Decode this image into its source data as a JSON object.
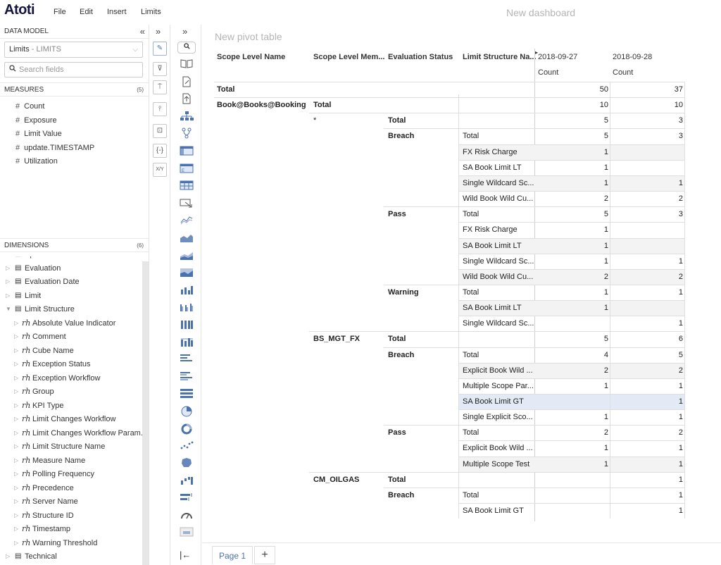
{
  "app": {
    "logo": "Atoti",
    "dashboard_title": "New dashboard"
  },
  "menu": [
    "File",
    "Edit",
    "Insert",
    "Limits"
  ],
  "left_panel": {
    "data_model_title": "DATA MODEL",
    "collapse_icon": "«",
    "cube": {
      "name": "Limits",
      "sep": " - ",
      "id": "LIMITS",
      "chevron": "⌵"
    },
    "search": {
      "placeholder": "Search fields",
      "value": ""
    },
    "measures_title": "MEASURES",
    "measures_count": "(5)",
    "measures": [
      "Count",
      "Exposure",
      "Limit Value",
      "update.TIMESTAMP",
      "Utilization"
    ],
    "dimensions_title": "DIMENSIONS",
    "dimensions_count": "(6)",
    "dimensions": [
      {
        "label": "Epoch",
        "kind": "dim"
      },
      {
        "label": "Evaluation",
        "kind": "dim"
      },
      {
        "label": "Evaluation Date",
        "kind": "dim"
      },
      {
        "label": "Limit",
        "kind": "dim"
      },
      {
        "label": "Limit Structure",
        "kind": "dim-open"
      },
      {
        "label": "Absolute Value Indicator",
        "kind": "hier"
      },
      {
        "label": "Comment",
        "kind": "hier"
      },
      {
        "label": "Cube Name",
        "kind": "hier"
      },
      {
        "label": "Exception Status",
        "kind": "hier"
      },
      {
        "label": "Exception Workflow",
        "kind": "hier"
      },
      {
        "label": "Group",
        "kind": "hier"
      },
      {
        "label": "KPI Type",
        "kind": "hier"
      },
      {
        "label": "Limit Changes Workflow",
        "kind": "hier"
      },
      {
        "label": "Limit Changes Workflow Param...",
        "kind": "hier"
      },
      {
        "label": "Limit Structure Name",
        "kind": "hier"
      },
      {
        "label": "Measure Name",
        "kind": "hier"
      },
      {
        "label": "Polling Frequency",
        "kind": "hier"
      },
      {
        "label": "Precedence",
        "kind": "hier"
      },
      {
        "label": "Server Name",
        "kind": "hier"
      },
      {
        "label": "Structure ID",
        "kind": "hier"
      },
      {
        "label": "Timestamp",
        "kind": "hier"
      },
      {
        "label": "Warning Threshold",
        "kind": "hier"
      },
      {
        "label": "Technical",
        "kind": "dim"
      }
    ]
  },
  "toolbar1": {
    "expand_icon": "»",
    "tools": [
      "pencil-icon",
      "filter-icon",
      "format-paint-icon",
      "sliders-icon",
      "terminal-icon",
      "braces-icon",
      "xy-icon"
    ],
    "tool_glyphs": [
      "✎",
      "⊽",
      "⍑",
      "⫯",
      "⊡",
      "{-}",
      "X/Y"
    ]
  },
  "toolbar2": {
    "expand_icon": "»",
    "search_glyph": "⚲",
    "footer_icon": "|←"
  },
  "pivot": {
    "title": "New pivot table",
    "row_headers": [
      "Scope Level Name",
      "Scope Level Mem...",
      "Evaluation Status",
      "Limit Structure Na..."
    ],
    "dates": [
      "2018-09-27",
      "2018-09-28"
    ],
    "measure": "Count",
    "rows": [
      {
        "c1": "Total",
        "c2": "",
        "c3": "",
        "c4": "",
        "v1": "50",
        "v2": "37",
        "bold": [
          1
        ]
      },
      {
        "c1": "Book@Books@Booking",
        "c2": "Total",
        "c3": "",
        "c4": "",
        "v1": "10",
        "v2": "10",
        "bold": [
          1,
          2
        ]
      },
      {
        "c1": "",
        "c2": "*",
        "c3": "Total",
        "c4": "",
        "v1": "5",
        "v2": "3",
        "bold": [
          3
        ]
      },
      {
        "c1": "",
        "c2": "",
        "c3": "Breach",
        "c4": "Total",
        "v1": "5",
        "v2": "3",
        "bold": [
          3
        ]
      },
      {
        "c1": "",
        "c2": "",
        "c3": "",
        "c4": "FX Risk Charge",
        "v1": "1",
        "v2": ""
      },
      {
        "c1": "",
        "c2": "",
        "c3": "",
        "c4": "SA Book Limit LT",
        "v1": "1",
        "v2": ""
      },
      {
        "c1": "",
        "c2": "",
        "c3": "",
        "c4": "Single Wildcard Sc...",
        "v1": "1",
        "v2": "1"
      },
      {
        "c1": "",
        "c2": "",
        "c3": "",
        "c4": "Wild Book Wild Cu...",
        "v1": "2",
        "v2": "2"
      },
      {
        "c1": "",
        "c2": "",
        "c3": "Pass",
        "c4": "Total",
        "v1": "5",
        "v2": "3",
        "bold": [
          3
        ]
      },
      {
        "c1": "",
        "c2": "",
        "c3": "",
        "c4": "FX Risk Charge",
        "v1": "1",
        "v2": ""
      },
      {
        "c1": "",
        "c2": "",
        "c3": "",
        "c4": "SA Book Limit LT",
        "v1": "1",
        "v2": ""
      },
      {
        "c1": "",
        "c2": "",
        "c3": "",
        "c4": "Single Wildcard Sc...",
        "v1": "1",
        "v2": "1"
      },
      {
        "c1": "",
        "c2": "",
        "c3": "",
        "c4": "Wild Book Wild Cu...",
        "v1": "2",
        "v2": "2"
      },
      {
        "c1": "",
        "c2": "",
        "c3": "Warning",
        "c4": "Total",
        "v1": "1",
        "v2": "1",
        "bold": [
          3
        ]
      },
      {
        "c1": "",
        "c2": "",
        "c3": "",
        "c4": "SA Book Limit LT",
        "v1": "1",
        "v2": ""
      },
      {
        "c1": "",
        "c2": "",
        "c3": "",
        "c4": "Single Wildcard Sc...",
        "v1": "",
        "v2": "1"
      },
      {
        "c1": "",
        "c2": "BS_MGT_FX",
        "c3": "Total",
        "c4": "",
        "v1": "5",
        "v2": "6",
        "bold": [
          2,
          3
        ]
      },
      {
        "c1": "",
        "c2": "",
        "c3": "Breach",
        "c4": "Total",
        "v1": "4",
        "v2": "5",
        "bold": [
          3
        ]
      },
      {
        "c1": "",
        "c2": "",
        "c3": "",
        "c4": "Explicit Book Wild ...",
        "v1": "2",
        "v2": "2"
      },
      {
        "c1": "",
        "c2": "",
        "c3": "",
        "c4": "Multiple Scope Par...",
        "v1": "1",
        "v2": "1"
      },
      {
        "c1": "",
        "c2": "",
        "c3": "",
        "c4": "SA Book Limit GT",
        "v1": "",
        "v2": "1",
        "selected": true
      },
      {
        "c1": "",
        "c2": "",
        "c3": "",
        "c4": "Single Explicit Sco...",
        "v1": "1",
        "v2": "1"
      },
      {
        "c1": "",
        "c2": "",
        "c3": "Pass",
        "c4": "Total",
        "v1": "2",
        "v2": "2",
        "bold": [
          3
        ]
      },
      {
        "c1": "",
        "c2": "",
        "c3": "",
        "c4": "Explicit Book Wild ...",
        "v1": "1",
        "v2": "1"
      },
      {
        "c1": "",
        "c2": "",
        "c3": "",
        "c4": "Multiple Scope Test",
        "v1": "1",
        "v2": "1"
      },
      {
        "c1": "",
        "c2": "CM_OILGAS",
        "c3": "Total",
        "c4": "",
        "v1": "",
        "v2": "1",
        "bold": [
          2,
          3
        ]
      },
      {
        "c1": "",
        "c2": "",
        "c3": "Breach",
        "c4": "Total",
        "v1": "",
        "v2": "1",
        "bold": [
          3
        ]
      },
      {
        "c1": "",
        "c2": "",
        "c3": "",
        "c4": "SA Book Limit GT",
        "v1": "",
        "v2": "1"
      }
    ]
  },
  "footer": {
    "page_tab": "Page 1",
    "add_page": "+"
  },
  "colors": {
    "accent": "#4a72b0",
    "logo": "#14143c",
    "selected_row": "#e3e9f5",
    "shaded_cell": "#f3f3f3"
  }
}
